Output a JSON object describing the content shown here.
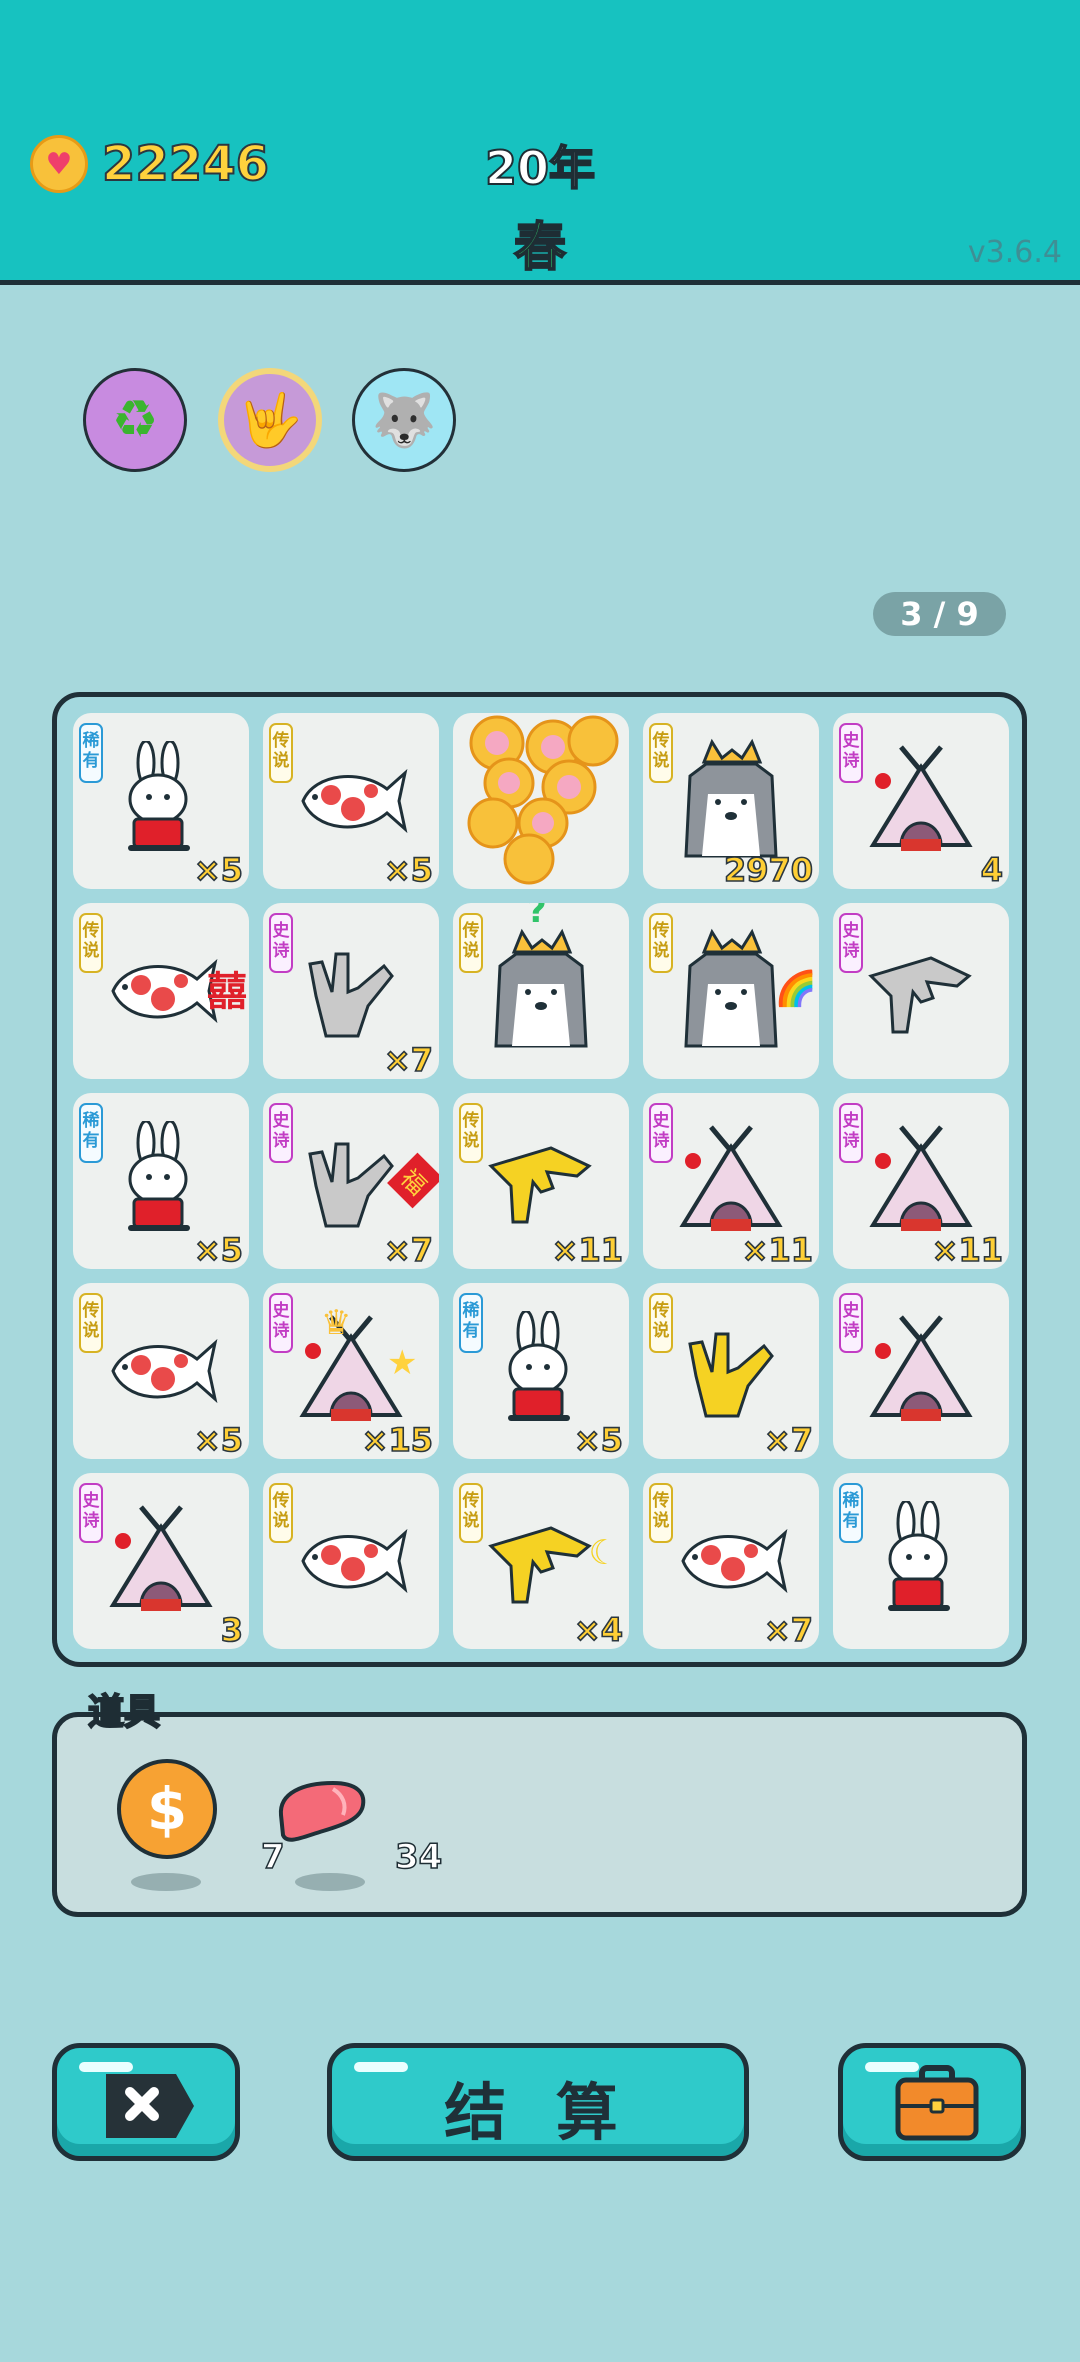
{
  "header": {
    "coins": "22246",
    "year": "20年",
    "season": "春",
    "version": "v3.6.4"
  },
  "skills": [
    {
      "icon": "recycle-icon",
      "glyph": "♻"
    },
    {
      "icon": "rock-hand-icon",
      "glyph": "🤟"
    },
    {
      "icon": "husky-coin-icon",
      "glyph": "🐺"
    }
  ],
  "pager": "3 / 9",
  "board": {
    "tags": {
      "rare": "稀有",
      "epic": "史诗",
      "legend": "传说"
    },
    "cells": [
      {
        "tag": "稀有",
        "type": "rabbit",
        "count": "×5"
      },
      {
        "tag": "传说",
        "type": "koi",
        "count": "×5"
      },
      {
        "tag": "",
        "type": "coins",
        "count": ""
      },
      {
        "tag": "传说",
        "type": "husky-king",
        "count": "2970"
      },
      {
        "tag": "史诗",
        "type": "tent",
        "count": "4"
      },
      {
        "tag": "传说",
        "type": "koi-xi",
        "count": ""
      },
      {
        "tag": "史诗",
        "type": "hand-gray",
        "count": "×7"
      },
      {
        "tag": "传说",
        "type": "husky-question",
        "count": ""
      },
      {
        "tag": "传说",
        "type": "husky-rainbow",
        "count": ""
      },
      {
        "tag": "史诗",
        "type": "hand-point-gray",
        "count": ""
      },
      {
        "tag": "稀有",
        "type": "rabbit",
        "count": "×5"
      },
      {
        "tag": "史诗",
        "type": "hand-fu",
        "count": "×7"
      },
      {
        "tag": "传说",
        "type": "hand-point-yellow",
        "count": "×11"
      },
      {
        "tag": "史诗",
        "type": "tent",
        "count": "×11"
      },
      {
        "tag": "史诗",
        "type": "tent",
        "count": "×11"
      },
      {
        "tag": "传说",
        "type": "koi",
        "count": "×5"
      },
      {
        "tag": "史诗",
        "type": "tent-king",
        "count": "×15"
      },
      {
        "tag": "稀有",
        "type": "rabbit",
        "count": "×5"
      },
      {
        "tag": "传说",
        "type": "hand-yellow",
        "count": "×7"
      },
      {
        "tag": "史诗",
        "type": "tent",
        "count": ""
      },
      {
        "tag": "史诗",
        "type": "tent",
        "count": "3"
      },
      {
        "tag": "传说",
        "type": "koi",
        "count": ""
      },
      {
        "tag": "传说",
        "type": "hand-moon",
        "count": "×4"
      },
      {
        "tag": "传说",
        "type": "koi",
        "count": "×7"
      },
      {
        "tag": "稀有",
        "type": "rabbit",
        "count": ""
      }
    ]
  },
  "items": {
    "label": "道具",
    "list": [
      {
        "icon": "dollar-coin-icon",
        "glyph": "$",
        "count": "7"
      },
      {
        "icon": "liver-icon",
        "glyph": "",
        "count": "34"
      }
    ]
  },
  "buttons": {
    "close_icon": "close-icon",
    "settle_label": "结 算",
    "bag_icon": "briefcase-icon"
  },
  "colors": {
    "header_bg": "#17c2c0",
    "page_bg": "#a7d8dc",
    "coin_text": "#ffd23d",
    "season_text": "#2fd16e",
    "button_bg": "#2fcaca"
  }
}
